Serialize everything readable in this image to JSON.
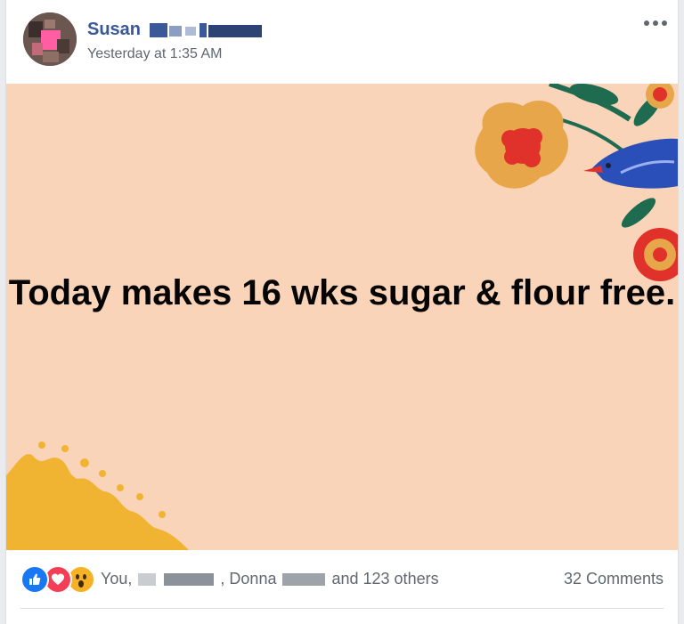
{
  "post": {
    "author_first": "Susan",
    "timestamp": "Yesterday at 1:35 AM",
    "more_icon": "more-horizontal-icon",
    "text": "Today makes 16 wks sugar & flour free.",
    "background_color": "#fad4b9"
  },
  "reactions": {
    "icons": [
      "like-icon",
      "love-icon",
      "wow-icon"
    ],
    "you_label": "You, ",
    "donna_label": ", Donna ",
    "others_label": "and 123 others",
    "comments_label": "32 Comments"
  },
  "colors": {
    "name": "#385898",
    "like": "#1877f2",
    "love": "#f33e58",
    "wow": "#f7b125"
  }
}
